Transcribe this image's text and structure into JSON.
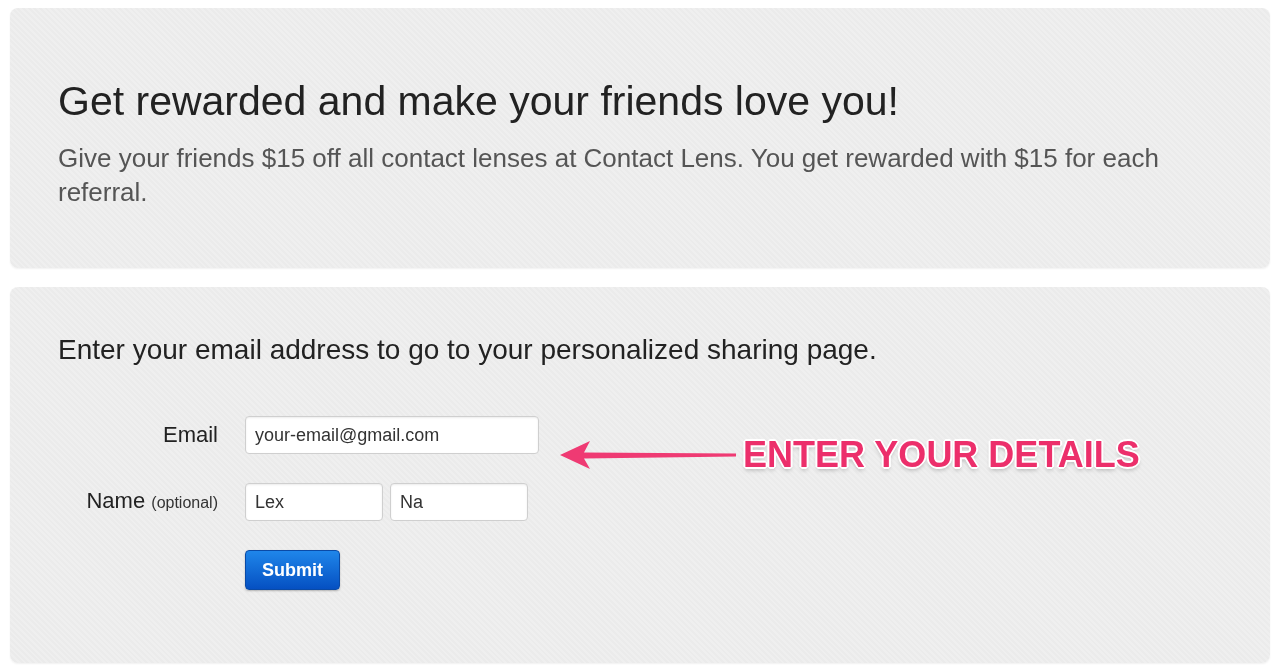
{
  "intro_panel": {
    "heading": "Get rewarded and make your friends love you!",
    "text": "Give your friends $15 off all contact lenses at Contact Lens. You get rewarded with $15 for each referral."
  },
  "signup_panel": {
    "instruction": "Enter your email address to go to your personalized sharing page.",
    "rows": [
      {
        "label": "Email",
        "inputs": [
          {
            "value": "your-email@gmail.com"
          }
        ]
      },
      {
        "label": "Name",
        "hint": "(optional)",
        "inputs": [
          {
            "value": "Lex"
          },
          {
            "value": "Na"
          }
        ]
      }
    ],
    "submit_button": {
      "label": "Submit"
    },
    "annotation": {
      "text": "ENTER YOUR DETAILS"
    }
  }
}
